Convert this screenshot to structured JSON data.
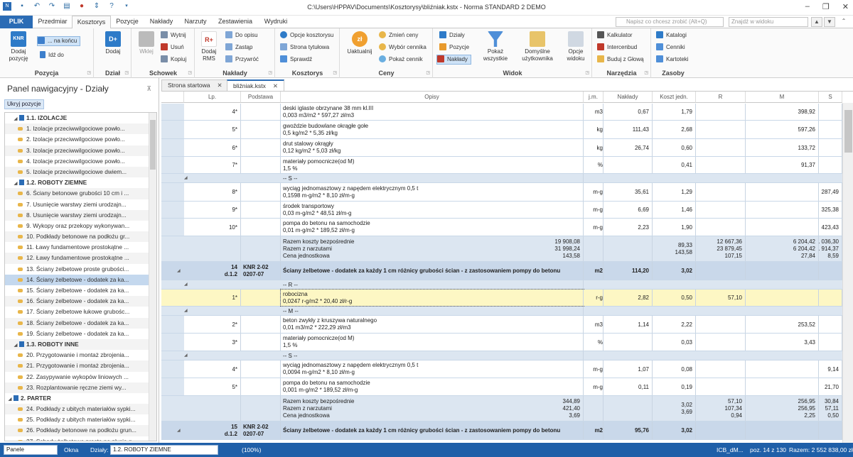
{
  "title": "C:\\Users\\HPPAV\\Documents\\Kosztorysy\\bliźniak.kstx - Norma STANDARD 2 DEMO",
  "menu_tabs": [
    "PLIK",
    "Przedmiar",
    "Kosztorys",
    "Pozycje",
    "Nakłady",
    "Narzuty",
    "Zestawienia",
    "Wydruki"
  ],
  "active_tab": "Kosztorys",
  "search_placeholder": "Napisz co chcesz zrobić (Alt+Q)",
  "find_placeholder": "Znajdź w widoku",
  "ribbon": {
    "pozycja": {
      "label": "Pozycja",
      "add": "Dodaj pozycję",
      "na_koncu": "... na końcu",
      "idz_do": "Idź do"
    },
    "dzial": {
      "label": "Dział",
      "add": "Dodaj"
    },
    "schowek": {
      "label": "Schowek",
      "wklej": "Wklej",
      "wytnij": "Wytnij",
      "usun": "Usuń",
      "kopiuj": "Kopiuj"
    },
    "naklady": {
      "label": "Nakłady",
      "dodaj_rms": "Dodaj RMS",
      "do_opisu": "Do opisu",
      "zastap": "Zastąp",
      "przywroc": "Przywróć"
    },
    "kosztorys": {
      "label": "Kosztorys",
      "opcje": "Opcje kosztorysu",
      "strona": "Strona tytułowa",
      "sprawdz": "Sprawdź"
    },
    "ceny": {
      "label": "Ceny",
      "aktualizuj": "Uaktualnij",
      "zmien": "Zmień ceny",
      "wybor": "Wybór cennika",
      "pokaz": "Pokaż cennik"
    },
    "widok": {
      "label": "Widok",
      "dzialy": "Działy",
      "pozycje": "Pozycje",
      "naklady": "Nakłady",
      "pokaz_wszystkie": "Pokaż wszystkie",
      "domyslne": "Domyślne użytkownika",
      "opcje_widoku": "Opcje widoku"
    },
    "narzedzia": {
      "label": "Narzędzia",
      "kalkulator": "Kalkulator",
      "intercenbud": "Intercenbud",
      "buduj": "Buduj z Głową"
    },
    "zasoby": {
      "label": "Zasoby",
      "katalogi": "Katalogi",
      "cenniki": "Cenniki",
      "kartoteki": "Kartoteki"
    }
  },
  "left_panel": {
    "title": "Panel nawigacyjny - Działy",
    "hide_button": "Ukryj pozycje",
    "tree": [
      {
        "text": "1.1. IZOLACJE",
        "level": "group"
      },
      {
        "text": "1. Izolacje przeciwwilgociowe powło...",
        "level": "item"
      },
      {
        "text": "2. Izolacje przeciwwilgociowe powło...",
        "level": "item"
      },
      {
        "text": "3. Izolacje przeciwwilgociowe powło...",
        "level": "item"
      },
      {
        "text": "4. Izolacje przeciwwilgociowe powło...",
        "level": "item"
      },
      {
        "text": "5. Izolacje przeciwwilgociowe dwiem...",
        "level": "item"
      },
      {
        "text": "1.2. ROBOTY ZIEMNE",
        "level": "group"
      },
      {
        "text": "6. Ściany betonowe grubości 10 cm i ...",
        "level": "item"
      },
      {
        "text": "7. Usunięcie warstwy ziemi urodzajn...",
        "level": "item"
      },
      {
        "text": "8. Usunięcie warstwy ziemi urodzajn...",
        "level": "item"
      },
      {
        "text": "9. Wykopy oraz przekopy wykonywan...",
        "level": "item"
      },
      {
        "text": "10. Podkłady betonowe na podłożu gr...",
        "level": "item"
      },
      {
        "text": "11. Ławy fundamentowe prostokątne ...",
        "level": "item"
      },
      {
        "text": "12. Ławy fundamentowe prostokątne ...",
        "level": "item"
      },
      {
        "text": "13. Ściany żelbetowe proste grubości...",
        "level": "item"
      },
      {
        "text": "14. Ściany żelbetowe - dodatek za ka...",
        "level": "item",
        "selected": true
      },
      {
        "text": "15. Ściany żelbetowe - dodatek za ka...",
        "level": "item"
      },
      {
        "text": "16. Ściany żelbetowe - dodatek za ka...",
        "level": "item"
      },
      {
        "text": "17. Ściany żelbetowe łukowe grubośc...",
        "level": "item"
      },
      {
        "text": "18. Ściany żelbetowe - dodatek za ka...",
        "level": "item"
      },
      {
        "text": "19. Ściany żelbetowe - dodatek za ka...",
        "level": "item"
      },
      {
        "text": "1.3. ROBOTY INNE",
        "level": "group"
      },
      {
        "text": "20. Przygotowanie i montaż zbrojenia...",
        "level": "item"
      },
      {
        "text": "21. Przygotowanie i montaż zbrojenia...",
        "level": "item"
      },
      {
        "text": "22. Zasypywanie wykopów liniowych ...",
        "level": "item"
      },
      {
        "text": "23. Rozplantowanie ręczne ziemi wy...",
        "level": "item"
      },
      {
        "text": "2. PARTER",
        "level": "top"
      },
      {
        "text": "24. Podkłady z ubitych materiałów sypki...",
        "level": "item"
      },
      {
        "text": "25. Podkłady z ubitych materiałów sypki...",
        "level": "item"
      },
      {
        "text": "26. Podkłady betonowe na podłożu grun...",
        "level": "item"
      },
      {
        "text": "27. Schody żelbetowe proste na płycie g...",
        "level": "item"
      }
    ]
  },
  "doc_tabs": [
    "Strona startowa",
    "bliźniak.kstx"
  ],
  "columns": [
    "Lp.",
    "Podstawa",
    "Opisy",
    "j.m.",
    "Nakłady",
    "Koszt jedn.",
    "R",
    "M",
    "S"
  ],
  "rows": [
    {
      "t": "n",
      "h": 24,
      "lp": "4*",
      "o1": "deski iglaste obrzynane 38 mm kl.III",
      "o2": "0,003 m3/m2 * 597,27 zł/m3",
      "jm": "m3",
      "nak": "0,67",
      "kj": "1,79",
      "r": "",
      "m": "398,92",
      "s": ""
    },
    {
      "t": "n",
      "h": 26,
      "lp": "5*",
      "o1": "gwoździe budowlane okrągłe gołe",
      "o2": "0,5 kg/m2 * 5,35 zł/kg",
      "jm": "kg",
      "nak": "111,43",
      "kj": "2,68",
      "r": "",
      "m": "597,26",
      "s": ""
    },
    {
      "t": "n",
      "h": 25,
      "lp": "6*",
      "o1": "drut stalowy okrągły",
      "o2": "0,12 kg/m2 * 5,03 zł/kg",
      "jm": "kg",
      "nak": "26,74",
      "kj": "0,60",
      "r": "",
      "m": "133,72",
      "s": ""
    },
    {
      "t": "n",
      "h": 24,
      "lp": "7*",
      "o1": "materiały pomocnicze(od M)",
      "o2": "1,5 %",
      "jm": "%",
      "nak": "",
      "kj": "0,41",
      "r": "",
      "m": "91,37",
      "s": ""
    },
    {
      "t": "g",
      "h": 13,
      "o1": "-- S --"
    },
    {
      "t": "n",
      "h": 26,
      "lp": "8*",
      "o1": "wyciąg jednomasztowy z napędem elektrycznym 0,5 t",
      "o2": "0,1598 m-g/m2 * 8,10 zł/m-g",
      "jm": "m-g",
      "nak": "35,61",
      "kj": "1,29",
      "r": "",
      "m": "",
      "s": "287,49"
    },
    {
      "t": "n",
      "h": 24,
      "lp": "9*",
      "o1": "środek transportowy",
      "o2": "0,03 m-g/m2 * 48,51 zł/m-g",
      "jm": "m-g",
      "nak": "6,69",
      "kj": "1,46",
      "r": "",
      "m": "",
      "s": "325,38"
    },
    {
      "t": "n",
      "h": 25,
      "lp": "10*",
      "o1": "pompa do betonu na samochodzie",
      "o2": "0,01 m-g/m2 * 189,52 zł/m-g",
      "jm": "m-g",
      "nak": "2,23",
      "kj": "1,90",
      "r": "",
      "m": "",
      "s": "423,43"
    },
    {
      "t": "sum",
      "h": 36,
      "lines": [
        "Razem koszty bezpośrednie",
        "Razem z narzutami",
        "Cena jednostkowa"
      ],
      "vals": [
        "19 908,08",
        "31 998,24",
        "143,58"
      ],
      "kj": [
        "89,33",
        "143,58",
        ""
      ],
      "r": [
        "12 667,36",
        "23 879,45",
        "107,15"
      ],
      "m": [
        "6 204,42",
        "6 204,42",
        "27,84"
      ],
      "s": [
        "1 036,30",
        "1 914,37",
        "8,59"
      ]
    },
    {
      "t": "h",
      "h": 26,
      "lp": "14",
      "lp2": "d.1.2",
      "p1": "KNR 2-02",
      "p2": "0207-07",
      "o1": "Ściany żelbetowe - dodatek za każdy 1 cm różnicy grubości ścian - z zastosowaniem pompy do betonu",
      "jm": "m2",
      "nak": "114,20",
      "kj": "3,02"
    },
    {
      "t": "g",
      "h": 13,
      "o1": "-- R --"
    },
    {
      "t": "y",
      "h": 24,
      "lp": "1*",
      "o1": "robocizna",
      "o2": "0,0247 r-g/m2 * 20,40 zł/r-g",
      "jm": "r-g",
      "nak": "2,82",
      "kj": "0,50",
      "r": "57,10",
      "m": "",
      "s": ""
    },
    {
      "t": "g",
      "h": 13,
      "o1": "-- M --"
    },
    {
      "t": "n",
      "h": 25,
      "lp": "2*",
      "o1": "beton zwykły z kruszywa naturalnego",
      "o2": "0,01 m3/m2 * 222,29 zł/m3",
      "jm": "m3",
      "nak": "1,14",
      "kj": "2,22",
      "r": "",
      "m": "253,52",
      "s": ""
    },
    {
      "t": "n",
      "h": 25,
      "lp": "3*",
      "o1": "materiały pomocnicze(od M)",
      "o2": "1,5 %",
      "jm": "%",
      "nak": "",
      "kj": "0,03",
      "r": "",
      "m": "3,43",
      "s": ""
    },
    {
      "t": "g",
      "h": 13,
      "o1": "-- S --"
    },
    {
      "t": "n",
      "h": 25,
      "lp": "4*",
      "o1": "wyciąg jednomasztowy z napędem elektrycznym 0,5 t",
      "o2": "0,0094 m-g/m2 * 8,10 zł/m-g",
      "jm": "m-g",
      "nak": "1,07",
      "kj": "0,08",
      "r": "",
      "m": "",
      "s": "9,14"
    },
    {
      "t": "n",
      "h": 25,
      "lp": "5*",
      "o1": "pompa do betonu na samochodzie",
      "o2": "0,001 m-g/m2 * 189,52 zł/m-g",
      "jm": "m-g",
      "nak": "0,11",
      "kj": "0,19",
      "r": "",
      "m": "",
      "s": "21,70"
    },
    {
      "t": "sum",
      "h": 36,
      "lines": [
        "Razem koszty bezpośrednie",
        "Razem z narzutami",
        "Cena jednostkowa"
      ],
      "vals": [
        "344,89",
        "421,40",
        "3,69"
      ],
      "kj": [
        "3,02",
        "3,69",
        ""
      ],
      "r": [
        "57,10",
        "107,34",
        "0,94"
      ],
      "m": [
        "256,95",
        "256,95",
        "2,25"
      ],
      "s": [
        "30,84",
        "57,11",
        "0,50"
      ]
    },
    {
      "t": "h",
      "h": 26,
      "lp": "15",
      "lp2": "d.1.2",
      "p1": "KNR 2-02",
      "p2": "0207-07",
      "o1": "Ściany żelbetowe - dodatek za każdy 1 cm różnicy grubości ścian - z zastosowaniem pompy do betonu",
      "jm": "m2",
      "nak": "95,76",
      "kj": "3,02"
    }
  ],
  "status": {
    "panele": "Panele",
    "okna": "Okna",
    "dzialy_label": "Działy:",
    "dzial_value": "1.2. ROBOTY ZIEMNE",
    "zoom": "(100%)",
    "user": "ICB_dM...",
    "poz": "poz. 14 z 130",
    "razem": "Razem: 2 552 838,00 zł"
  }
}
